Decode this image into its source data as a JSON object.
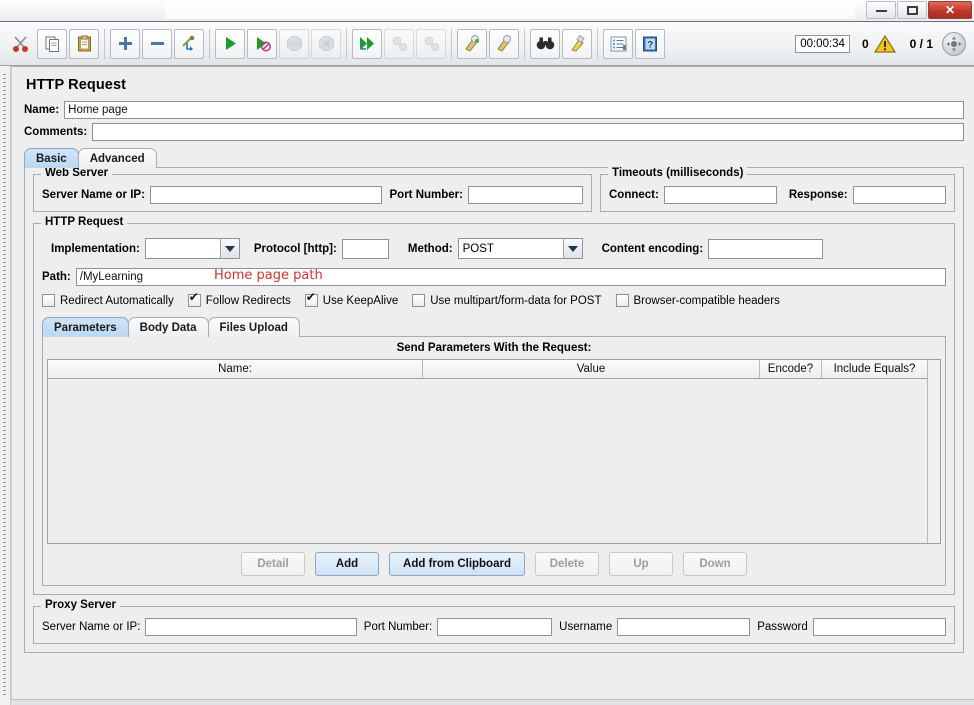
{
  "window": {
    "buttons": {
      "minimize": "minimize-icon",
      "maximize": "maximize-icon",
      "close": "✕"
    }
  },
  "toolbar": {
    "items": [
      {
        "name": "cut-button",
        "icon": "✂",
        "enabled": true
      },
      {
        "name": "copy-button",
        "icon": "⧉",
        "enabled": true
      },
      {
        "name": "paste-button",
        "icon": "📋",
        "enabled": true
      },
      {
        "name": "expand-all-button",
        "icon": "✚",
        "enabled": true
      },
      {
        "name": "collapse-all-button",
        "icon": "━",
        "enabled": true
      },
      {
        "name": "toggle-button",
        "icon": "⤵",
        "enabled": true
      },
      {
        "name": "start-button",
        "icon": "▶",
        "enabled": true
      },
      {
        "name": "start-no-timers-button",
        "icon": "▶",
        "enabled": true
      },
      {
        "name": "stop-button",
        "icon": "⬣",
        "enabled": false
      },
      {
        "name": "shutdown-button",
        "icon": "⬤",
        "enabled": false
      },
      {
        "name": "start-remote-all-button",
        "icon": "▶▶",
        "enabled": true
      },
      {
        "name": "stop-remote-all-button",
        "icon": "◍",
        "enabled": false
      },
      {
        "name": "shutdown-remote-all-button",
        "icon": "◍",
        "enabled": false
      },
      {
        "name": "clear-button",
        "icon": "🧹",
        "enabled": true
      },
      {
        "name": "clear-all-button",
        "icon": "🧹",
        "enabled": true
      },
      {
        "name": "search-button",
        "icon": "🔍",
        "enabled": true
      },
      {
        "name": "search-reset-button",
        "icon": "🖌",
        "enabled": true
      },
      {
        "name": "function-helper-button",
        "icon": "☰",
        "enabled": true
      },
      {
        "name": "help-button",
        "icon": "?",
        "enabled": true
      }
    ],
    "elapsed_time": "00:00:34",
    "error_count": "0",
    "warning_icon": "warning-triangle-icon",
    "thread_count": "0 / 1",
    "thread_status_icon": "thread-status-icon"
  },
  "panel": {
    "title": "HTTP Request",
    "name_label": "Name:",
    "name_value": "Home page",
    "comments_label": "Comments:",
    "comments_value": "",
    "tabs": [
      {
        "label": "Basic",
        "selected": true
      },
      {
        "label": "Advanced",
        "selected": false
      }
    ],
    "web_server": {
      "group_title": "Web Server",
      "server_label": "Server Name or IP:",
      "server_value": "",
      "port_label": "Port Number:",
      "port_value": ""
    },
    "timeouts": {
      "group_title": "Timeouts (milliseconds)",
      "connect_label": "Connect:",
      "connect_value": "",
      "response_label": "Response:",
      "response_value": ""
    },
    "http_request": {
      "group_title": "HTTP Request",
      "implementation_label": "Implementation:",
      "implementation_value": "",
      "protocol_label": "Protocol [http]:",
      "protocol_value": "",
      "method_label": "Method:",
      "method_value": "POST",
      "content_encoding_label": "Content encoding:",
      "content_encoding_value": "",
      "path_label": "Path:",
      "path_value": "/MyLearning",
      "annotation": "Home page path",
      "annotation_color": "#d0342c",
      "checkboxes": [
        {
          "label": "Redirect Automatically",
          "checked": false
        },
        {
          "label": "Follow Redirects",
          "checked": true
        },
        {
          "label": "Use KeepAlive",
          "checked": true
        },
        {
          "label": "Use multipart/form-data for POST",
          "checked": false
        },
        {
          "label": "Browser-compatible headers",
          "checked": false
        }
      ]
    },
    "param_tabs": [
      {
        "label": "Parameters",
        "selected": true
      },
      {
        "label": "Body Data",
        "selected": false
      },
      {
        "label": "Files Upload",
        "selected": false
      }
    ],
    "parameters_table": {
      "caption": "Send Parameters With the Request:",
      "columns": [
        "Name:",
        "Value",
        "Encode?",
        "Include Equals?"
      ],
      "rows": []
    },
    "table_buttons": [
      {
        "label": "Detail",
        "enabled": false,
        "primary": false
      },
      {
        "label": "Add",
        "enabled": true,
        "primary": true
      },
      {
        "label": "Add from Clipboard",
        "enabled": true,
        "primary": true
      },
      {
        "label": "Delete",
        "enabled": false,
        "primary": false
      },
      {
        "label": "Up",
        "enabled": false,
        "primary": false
      },
      {
        "label": "Down",
        "enabled": false,
        "primary": false
      }
    ],
    "proxy_server": {
      "group_title": "Proxy Server",
      "server_label": "Server Name or IP:",
      "server_value": "",
      "port_label": "Port Number:",
      "port_value": "",
      "username_label": "Username",
      "username_value": "",
      "password_label": "Password",
      "password_value": ""
    }
  }
}
